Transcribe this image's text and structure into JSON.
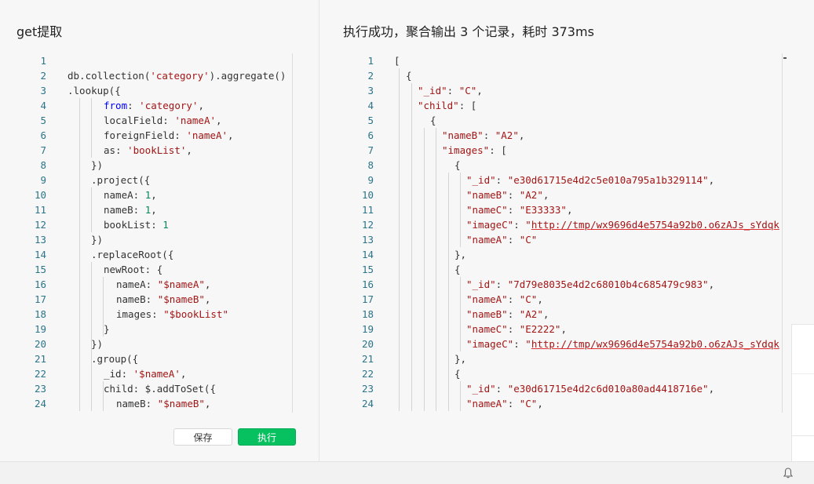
{
  "left_panel": {
    "title": "get提取",
    "lines": [
      [],
      [
        [
          "p",
          "db.collection("
        ],
        [
          "s",
          "'category'"
        ],
        [
          "p",
          ").aggregate()"
        ]
      ],
      [
        [
          "p",
          ".lookup({"
        ]
      ],
      [
        [
          "k",
          "from"
        ],
        [
          "p",
          ": "
        ],
        [
          "s",
          "'category'"
        ],
        [
          "p",
          ","
        ]
      ],
      [
        [
          "p",
          "localField: "
        ],
        [
          "s",
          "'nameA'"
        ],
        [
          "p",
          ","
        ]
      ],
      [
        [
          "p",
          "foreignField: "
        ],
        [
          "s",
          "'nameA'"
        ],
        [
          "p",
          ","
        ]
      ],
      [
        [
          "p",
          "as: "
        ],
        [
          "s",
          "'bookList'"
        ],
        [
          "p",
          ","
        ]
      ],
      [
        [
          "p",
          "})"
        ]
      ],
      [
        [
          "p",
          ".project({"
        ]
      ],
      [
        [
          "p",
          "nameA: "
        ],
        [
          "n",
          "1"
        ],
        [
          "p",
          ","
        ]
      ],
      [
        [
          "p",
          "nameB: "
        ],
        [
          "n",
          "1"
        ],
        [
          "p",
          ","
        ]
      ],
      [
        [
          "p",
          "bookList: "
        ],
        [
          "n",
          "1"
        ]
      ],
      [
        [
          "p",
          "})"
        ]
      ],
      [
        [
          "p",
          ".replaceRoot({"
        ]
      ],
      [
        [
          "p",
          "newRoot: {"
        ]
      ],
      [
        [
          "p",
          "nameA: "
        ],
        [
          "s",
          "\"$nameA\""
        ],
        [
          "p",
          ","
        ]
      ],
      [
        [
          "p",
          "nameB: "
        ],
        [
          "s",
          "\"$nameB\""
        ],
        [
          "p",
          ","
        ]
      ],
      [
        [
          "p",
          "images: "
        ],
        [
          "s",
          "\"$bookList\""
        ]
      ],
      [
        [
          "p",
          "}"
        ]
      ],
      [
        [
          "p",
          "})"
        ]
      ],
      [
        [
          "p",
          ".group({"
        ]
      ],
      [
        [
          "p",
          "_id: "
        ],
        [
          "s",
          "'$nameA'"
        ],
        [
          "p",
          ","
        ]
      ],
      [
        [
          "p",
          "child: $.addToSet({"
        ]
      ],
      [
        [
          "p",
          "nameB: "
        ],
        [
          "s",
          "\"$nameB\""
        ],
        [
          "p",
          ","
        ]
      ]
    ]
  },
  "right_panel": {
    "title": "执行成功，聚合输出 3 个记录，耗时 373ms",
    "lines": [
      [
        [
          "p",
          "["
        ]
      ],
      [
        [
          "p",
          "{"
        ]
      ],
      [
        [
          "s",
          "\"_id\""
        ],
        [
          "p",
          ": "
        ],
        [
          "s",
          "\"C\""
        ],
        [
          "p",
          ","
        ]
      ],
      [
        [
          "s",
          "\"child\""
        ],
        [
          "p",
          ": ["
        ]
      ],
      [
        [
          "p",
          "{"
        ]
      ],
      [
        [
          "s",
          "\"nameB\""
        ],
        [
          "p",
          ": "
        ],
        [
          "s",
          "\"A2\""
        ],
        [
          "p",
          ","
        ]
      ],
      [
        [
          "s",
          "\"images\""
        ],
        [
          "p",
          ": ["
        ]
      ],
      [
        [
          "p",
          "{"
        ]
      ],
      [
        [
          "s",
          "\"_id\""
        ],
        [
          "p",
          ": "
        ],
        [
          "s",
          "\"e30d61715e4d2c5e010a795a1b329114\""
        ],
        [
          "p",
          ","
        ]
      ],
      [
        [
          "s",
          "\"nameB\""
        ],
        [
          "p",
          ": "
        ],
        [
          "s",
          "\"A2\""
        ],
        [
          "p",
          ","
        ]
      ],
      [
        [
          "s",
          "\"nameC\""
        ],
        [
          "p",
          ": "
        ],
        [
          "s",
          "\"E33333\""
        ],
        [
          "p",
          ","
        ]
      ],
      [
        [
          "s",
          "\"imageC\""
        ],
        [
          "p",
          ": "
        ],
        [
          "s",
          "\""
        ],
        [
          "u",
          "http://tmp/wx9696d4e5754a92b0.o6zAJs_sYdqk"
        ]
      ],
      [
        [
          "s",
          "\"nameA\""
        ],
        [
          "p",
          ": "
        ],
        [
          "s",
          "\"C\""
        ]
      ],
      [
        [
          "p",
          "},"
        ]
      ],
      [
        [
          "p",
          "{"
        ]
      ],
      [
        [
          "s",
          "\"_id\""
        ],
        [
          "p",
          ": "
        ],
        [
          "s",
          "\"7d79e8035e4d2c68010b4c685479c983\""
        ],
        [
          "p",
          ","
        ]
      ],
      [
        [
          "s",
          "\"nameA\""
        ],
        [
          "p",
          ": "
        ],
        [
          "s",
          "\"C\""
        ],
        [
          "p",
          ","
        ]
      ],
      [
        [
          "s",
          "\"nameB\""
        ],
        [
          "p",
          ": "
        ],
        [
          "s",
          "\"A2\""
        ],
        [
          "p",
          ","
        ]
      ],
      [
        [
          "s",
          "\"nameC\""
        ],
        [
          "p",
          ": "
        ],
        [
          "s",
          "\"E2222\""
        ],
        [
          "p",
          ","
        ]
      ],
      [
        [
          "s",
          "\"imageC\""
        ],
        [
          "p",
          ": "
        ],
        [
          "s",
          "\""
        ],
        [
          "u",
          "http://tmp/wx9696d4e5754a92b0.o6zAJs_sYdqk"
        ]
      ],
      [
        [
          "p",
          "},"
        ]
      ],
      [
        [
          "p",
          "{"
        ]
      ],
      [
        [
          "s",
          "\"_id\""
        ],
        [
          "p",
          ": "
        ],
        [
          "s",
          "\"e30d61715e4d2c6d010a80ad4418716e\""
        ],
        [
          "p",
          ","
        ]
      ],
      [
        [
          "s",
          "\"nameA\""
        ],
        [
          "p",
          ": "
        ],
        [
          "s",
          "\"C\""
        ],
        [
          "p",
          ","
        ]
      ]
    ]
  },
  "buttons": {
    "save_label": "保存",
    "run_label": "执行"
  },
  "icons": {
    "footer_icon": "bell-icon"
  },
  "colors": {
    "run_button": "#07c160",
    "line_number": "#2b7489",
    "string": "#a31515",
    "keyword": "#0000ff",
    "number": "#098658"
  }
}
